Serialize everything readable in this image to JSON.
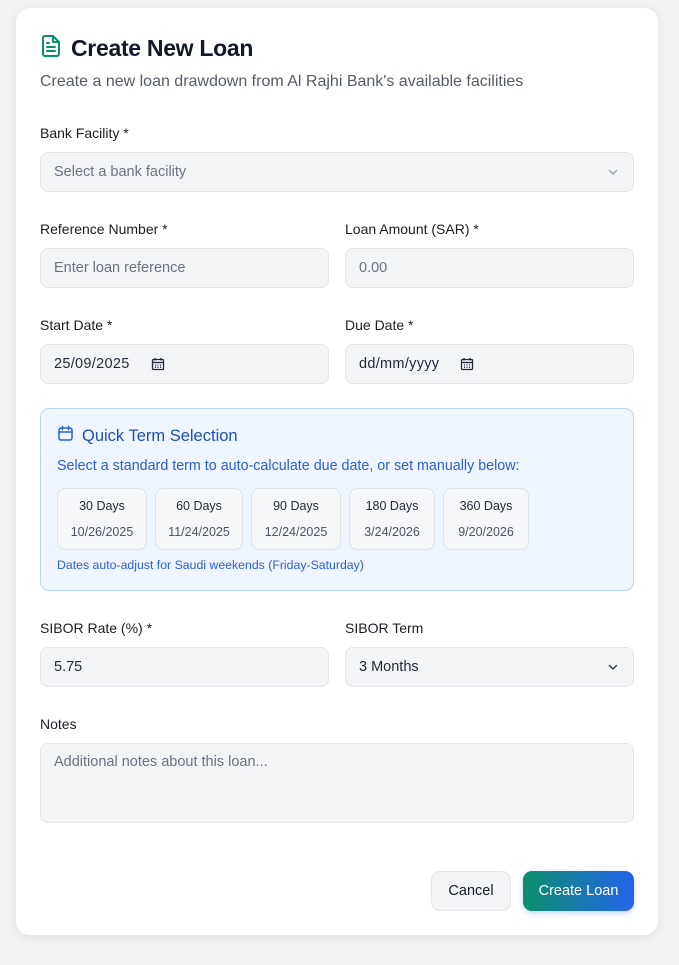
{
  "header": {
    "title": "Create New Loan",
    "subtitle": "Create a new loan drawdown from Al Rajhi Bank's available facilities",
    "icon": "document-icon",
    "icon_color": "#0a8f6d"
  },
  "form": {
    "bank_facility": {
      "label": "Bank Facility *",
      "placeholder": "Select a bank facility"
    },
    "reference_number": {
      "label": "Reference Number *",
      "placeholder": "Enter loan reference"
    },
    "loan_amount": {
      "label": "Loan Amount (SAR) *",
      "placeholder": "0.00"
    },
    "start_date": {
      "label": "Start Date *",
      "value": "25/09/2025"
    },
    "due_date": {
      "label": "Due Date *",
      "value": "dd/mm/yyyy"
    },
    "sibor_rate": {
      "label": "SIBOR Rate (%) *",
      "value": "5.75"
    },
    "sibor_term": {
      "label": "SIBOR Term",
      "value": "3 Months"
    },
    "notes": {
      "label": "Notes",
      "placeholder": "Additional notes about this loan..."
    }
  },
  "quick_term": {
    "title": "Quick Term Selection",
    "description": "Select a standard term to auto-calculate due date, or set manually below:",
    "note": "Dates auto-adjust for Saudi weekends (Friday-Saturday)",
    "options": [
      {
        "days": "30 Days",
        "date": "10/26/2025"
      },
      {
        "days": "60 Days",
        "date": "11/24/2025"
      },
      {
        "days": "90 Days",
        "date": "12/24/2025"
      },
      {
        "days": "180 Days",
        "date": "3/24/2026"
      },
      {
        "days": "360 Days",
        "date": "9/20/2026"
      }
    ],
    "accent_color": "#2c5fd0"
  },
  "actions": {
    "cancel": "Cancel",
    "create": "Create Loan"
  }
}
